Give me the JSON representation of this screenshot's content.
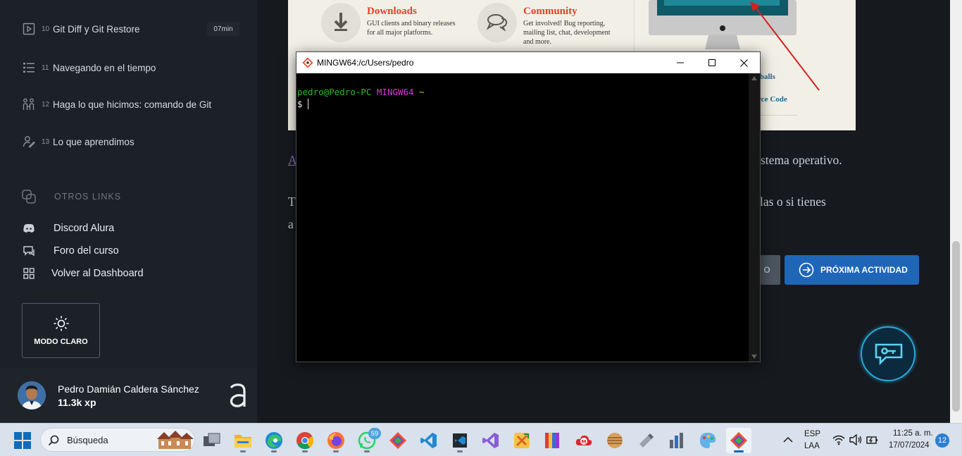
{
  "sidebar": {
    "lessons": [
      {
        "num": "10",
        "title": "Git Diff y Git Restore",
        "duration": "07min",
        "icon": "video-icon"
      },
      {
        "num": "11",
        "title": "Navegando en el tiempo",
        "icon": "list-icon"
      },
      {
        "num": "12",
        "title": "Haga lo que hicimos: comando de Git",
        "icon": "do-what-we-did-icon"
      },
      {
        "num": "13",
        "title": "Lo que aprendimos",
        "icon": "learned-icon"
      }
    ],
    "otros_links_label": "OTROS LINKS",
    "links": [
      {
        "label": "Discord Alura",
        "icon": "discord-icon"
      },
      {
        "label": "Foro del curso",
        "icon": "forum-icon"
      },
      {
        "label": "Volver al Dashboard",
        "icon": "dashboard-icon"
      }
    ],
    "mode_button": "MODO CLARO",
    "user": {
      "name": "Pedro Damián Caldera Sánchez",
      "xp": "11.3k xp"
    }
  },
  "git_image": {
    "downloads_title": "Downloads",
    "downloads_text_1": "GUI clients and binary releases",
    "downloads_text_2": "for all major platforms.",
    "community_title": "Community",
    "community_text_1": "Get involved! Bug reporting,",
    "community_text_2": "mailing list, chat, development",
    "community_text_3": "and more.",
    "link_1": "rballs",
    "link_2": "urce Code"
  },
  "content": {
    "link_fragment": "A",
    "text_line_1": "stema operativo.",
    "text_line_2_start": "T",
    "text_line_2_end": "las o si tienes",
    "text_line_3_start": "a",
    "prev_button_fragment": "O",
    "next_button": "PRÓXIMA ACTIVIDAD"
  },
  "terminal": {
    "title": "MINGW64:/c/Users/pedro",
    "user_host": "pedro@Pedro-PC",
    "env": "MINGW64",
    "path": "~",
    "prompt": "$"
  },
  "taskbar": {
    "search_placeholder": "Búsqueda",
    "apps": [
      {
        "name": "task-view",
        "badge": ""
      },
      {
        "name": "file-explorer",
        "badge": ""
      },
      {
        "name": "edge",
        "badge": ""
      },
      {
        "name": "chrome",
        "badge": ""
      },
      {
        "name": "firefox",
        "badge": ""
      },
      {
        "name": "whatsapp",
        "badge": "59"
      },
      {
        "name": "git-gui",
        "badge": ""
      },
      {
        "name": "vscode",
        "badge": ""
      },
      {
        "name": "vscode-insiders",
        "badge": ""
      },
      {
        "name": "visual-studio",
        "badge": ""
      },
      {
        "name": "tools-app",
        "badge": ""
      },
      {
        "name": "color-bars-app",
        "badge": ""
      },
      {
        "name": "mega",
        "badge": ""
      },
      {
        "name": "globe-app",
        "badge": ""
      },
      {
        "name": "usb-app",
        "badge": ""
      },
      {
        "name": "stats-app",
        "badge": ""
      },
      {
        "name": "paint-app",
        "badge": ""
      },
      {
        "name": "git-bash",
        "badge": ""
      }
    ],
    "lang_1": "ESP",
    "lang_2": "LAA",
    "time": "11:25 a. m.",
    "date": "17/07/2024",
    "notifications": "12"
  }
}
